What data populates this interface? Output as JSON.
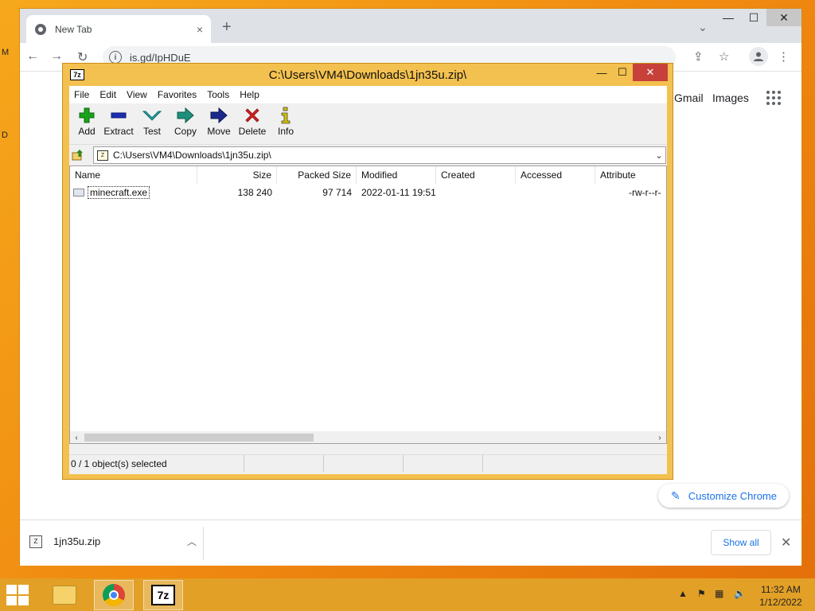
{
  "desktop": {
    "edge_labels": [
      "M",
      "D"
    ]
  },
  "chrome": {
    "tab_title": "New Tab",
    "tab_close_icon": "×",
    "new_tab_icon": "+",
    "tab_search_icon": "⌄",
    "window_controls": {
      "minimize": "—",
      "maximize": "☐",
      "close": "✕"
    },
    "url": "is.gd/IpHDuE",
    "ntp_links": {
      "gmail": "Gmail",
      "images": "Images"
    },
    "customize_label": "Customize Chrome",
    "downloads": {
      "file_name": "1jn35u.zip",
      "show_all": "Show all",
      "close": "✕"
    }
  },
  "sevenzip": {
    "title": "C:\\Users\\VM4\\Downloads\\1jn35u.zip\\",
    "logo": "7z",
    "window_controls": {
      "minimize": "—",
      "maximize": "☐",
      "close": "✕"
    },
    "menu": [
      "File",
      "Edit",
      "View",
      "Favorites",
      "Tools",
      "Help"
    ],
    "toolbar": [
      {
        "label": "Add",
        "icon": "plus-icon",
        "color": "#1aa31a"
      },
      {
        "label": "Extract",
        "icon": "minus-icon",
        "color": "#1c2fb0"
      },
      {
        "label": "Test",
        "icon": "check-icon",
        "color": "#25a7a7"
      },
      {
        "label": "Copy",
        "icon": "copy-arrow-icon",
        "color": "#1e8f7a"
      },
      {
        "label": "Move",
        "icon": "move-arrow-icon",
        "color": "#1a2a8c"
      },
      {
        "label": "Delete",
        "icon": "x-icon",
        "color": "#d32020"
      },
      {
        "label": "Info",
        "icon": "info-icon",
        "color": "#d4c200"
      }
    ],
    "address": "C:\\Users\\VM4\\Downloads\\1jn35u.zip\\",
    "columns": [
      "Name",
      "Size",
      "Packed Size",
      "Modified",
      "Created",
      "Accessed",
      "Attribute"
    ],
    "rows": [
      {
        "name": "minecraft.exe",
        "size": "138 240",
        "packed": "97 714",
        "modified": "2022-01-11 19:51",
        "created": "",
        "accessed": "",
        "attributes": "-rw-r--r-"
      }
    ],
    "status": "0 / 1 object(s) selected"
  },
  "taskbar": {
    "time": "11:32 AM",
    "date": "1/12/2022",
    "apps": [
      "file-explorer",
      "chrome",
      "7-zip"
    ]
  }
}
